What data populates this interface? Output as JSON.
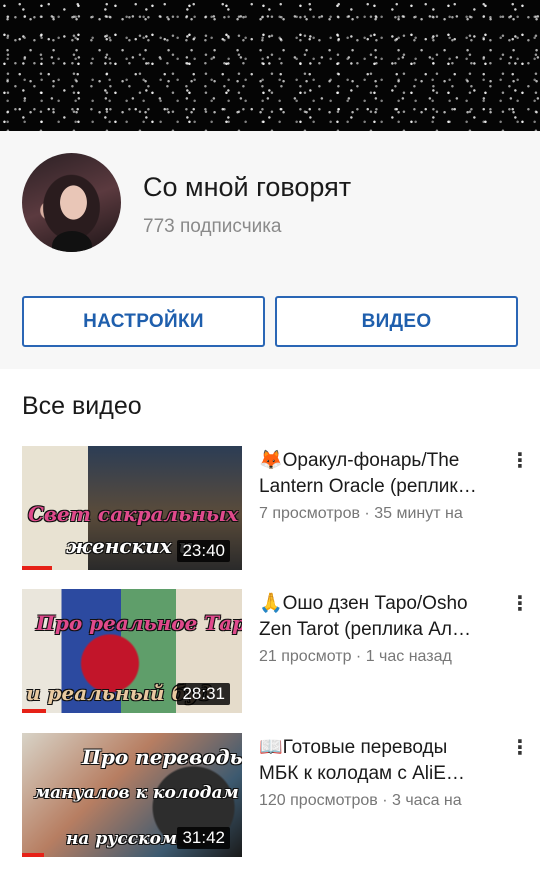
{
  "channel": {
    "name": "Со мной говорят",
    "subscribers": "773 подписчика"
  },
  "buttons": {
    "settings": "НАСТРОЙКИ",
    "videos": "ВИДЕО"
  },
  "section": {
    "title": "Все видео"
  },
  "icons": {
    "more": "⋮"
  },
  "videos": [
    {
      "title_line1": "🦊Оракул-фонарь/The",
      "title_line2": "Lantern Oracle (реплик…",
      "meta": "7 просмотров · 35 минут на",
      "duration": "23:40",
      "thumb_text_1": "Свет сакральных",
      "thumb_text_2": "женских и",
      "watch_progress": 0.14
    },
    {
      "title_line1": "🙏Ошо дзен Таро/Osho",
      "title_line2": "Zen Tarot (реплика Ал…",
      "meta": "21 просмотр · 1 час назад",
      "duration": "28:31",
      "thumb_text_1": "Про реальное Таро",
      "thumb_text_2": "и реальный буд",
      "watch_progress": 0.11
    },
    {
      "title_line1": "📖Готовые переводы",
      "title_line2": "МБК к колодам с AliE…",
      "meta": "120 просмотров · 3 часа на",
      "duration": "31:42",
      "thumb_text_1": "Про переводы",
      "thumb_text_2": "мануалов к колодам",
      "thumb_text_3": "на русском",
      "watch_progress": 0.1
    }
  ]
}
